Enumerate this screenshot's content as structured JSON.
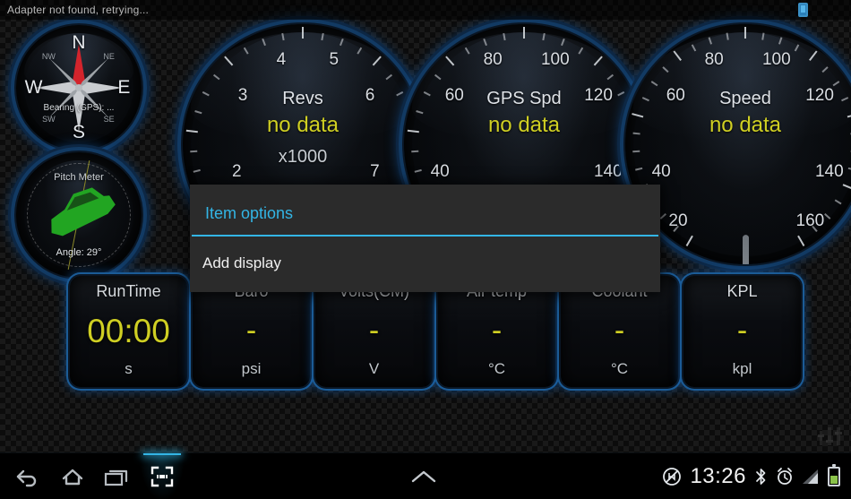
{
  "status_bar": {
    "message": "Adapter not found, retrying...",
    "right_icon": "tablet-icon"
  },
  "compass": {
    "name": "compass-gauge",
    "cardinals": [
      "N",
      "E",
      "S",
      "W"
    ],
    "intercardinals": [
      "NW",
      "NE",
      "SW",
      "SE"
    ],
    "bearing_label": "Bearing (GPS): ...",
    "needle_color": "#d3242c"
  },
  "pitch_meter": {
    "name": "pitch-meter-gauge",
    "title": "Pitch Meter",
    "angle_label": "Angle: 29°",
    "vehicle_color": "#22a522"
  },
  "gauges": [
    {
      "id": "revs",
      "title": "Revs",
      "value": "no data",
      "unit": "x1000",
      "ticks": [
        "2",
        "3",
        "4",
        "5",
        "6",
        "7"
      ],
      "value_color": "#cfcf23"
    },
    {
      "id": "gps-speed",
      "title": "GPS Spd",
      "value": "no data",
      "unit": "",
      "ticks": [
        "40",
        "60",
        "80",
        "100",
        "120",
        "140"
      ],
      "value_color": "#cfcf23"
    },
    {
      "id": "speed",
      "title": "Speed",
      "value": "no data",
      "unit": "",
      "ticks": [
        "20",
        "40",
        "60",
        "80",
        "100",
        "120",
        "140",
        "160"
      ],
      "value_color": "#cfcf23"
    }
  ],
  "cards": [
    {
      "title": "RunTime",
      "value": "00:00",
      "unit": "s"
    },
    {
      "title": "Baro",
      "value": "-",
      "unit": "psi"
    },
    {
      "title": "Volts(CM)",
      "value": "-",
      "unit": "V"
    },
    {
      "title": "Air temp",
      "value": "-",
      "unit": "°C"
    },
    {
      "title": "Coolant",
      "value": "-",
      "unit": "°C"
    },
    {
      "title": "KPL",
      "value": "-",
      "unit": "kpl"
    }
  ],
  "dialog": {
    "title": "Item options",
    "accent_color": "#33b5e5",
    "items": [
      {
        "label": "Add display"
      }
    ]
  },
  "nav_bar": {
    "buttons": [
      {
        "name": "back-icon"
      },
      {
        "name": "home-icon"
      },
      {
        "name": "recents-icon"
      },
      {
        "name": "screenshot-icon"
      }
    ],
    "center_icon": "chevron-up-icon",
    "clock": "13:26",
    "tray_icons": [
      "mute-icon",
      "bluetooth-icon",
      "alarm-icon",
      "signal-icon",
      "battery-icon"
    ]
  },
  "overlay": {
    "eq_icon": "equalizer-icon"
  }
}
